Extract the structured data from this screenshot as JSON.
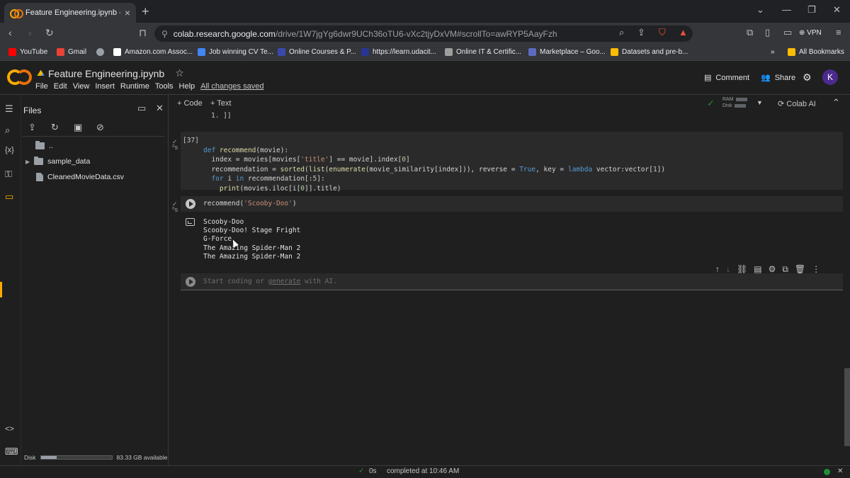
{
  "browser": {
    "tab_title": "Feature Engineering.ipynb - Co",
    "url_host": "colab.research.google.com",
    "url_path": "/drive/1W7jgYg6dwr9UCh36oTU6-vXc2tjyDxVM#scrollTo=awRYP5AayFzh",
    "vpn_label": "VPN"
  },
  "bookmarks": [
    {
      "label": "YouTube",
      "color": "#ff0000"
    },
    {
      "label": "Gmail",
      "color": "#ea4335"
    },
    {
      "label": "Amazon.com Assoc...",
      "color": "#ffffff"
    },
    {
      "label": "Job winning CV Te...",
      "color": "#4285f4"
    },
    {
      "label": "Online Courses & P...",
      "color": "#3949ab"
    },
    {
      "label": "https://learn.udacit...",
      "color": "#283593"
    },
    {
      "label": "Online IT & Certific...",
      "color": "#9e9e9e"
    },
    {
      "label": "Marketplace – Goo...",
      "color": "#5c6bc0"
    },
    {
      "label": "Datasets and pre-b...",
      "color": "#fbbc04"
    }
  ],
  "all_bookmarks_label": "All Bookmarks",
  "colab": {
    "notebook_name": "Feature Engineering.ipynb",
    "menu": [
      "File",
      "Edit",
      "View",
      "Insert",
      "Runtime",
      "Tools",
      "Help"
    ],
    "saved_status": "All changes saved",
    "comment_label": "Comment",
    "share_label": "Share",
    "avatar_letter": "K"
  },
  "files_panel": {
    "title": "Files",
    "parent_dir": "..",
    "items": [
      "sample_data",
      "CleanedMovieData.csv"
    ],
    "disk_label": "Disk",
    "disk_available": "83.33 GB available",
    "disk_used_fraction": 0.22
  },
  "toolbar": {
    "add_code": "+ Code",
    "add_text": "+ Text",
    "ram_label": "RAM",
    "disk_label": "Disk",
    "colab_ai": "Colab AI"
  },
  "previous_output": "1.       ]]",
  "cells": {
    "def_cell": {
      "exec_count": "[37]",
      "lines": [
        "def recommend(movie):",
        "  index = movies[movies['title'] == movie].index[0]",
        "  recommendation = sorted(list(enumerate(movie_similarity[index])), reverse = True, key = lambda vector:vector[1])",
        "  for i in recommendation[:5]:",
        "    print(movies.iloc[i[0]].title)"
      ]
    },
    "call_cell": {
      "code": "recommend('Scooby-Doo')",
      "output": [
        "Scooby-Doo",
        "Scooby-Doo! Stage Fright",
        "G-Force",
        "The Amazing Spider-Man 2",
        "The Amazing Spider-Man 2"
      ]
    },
    "empty_cell": {
      "placeholder_start": "Start coding or ",
      "placeholder_link": "generate",
      "placeholder_end": " with AI."
    }
  },
  "status_bar": {
    "duration": "0s",
    "completed": "completed at 10:46 AM"
  }
}
